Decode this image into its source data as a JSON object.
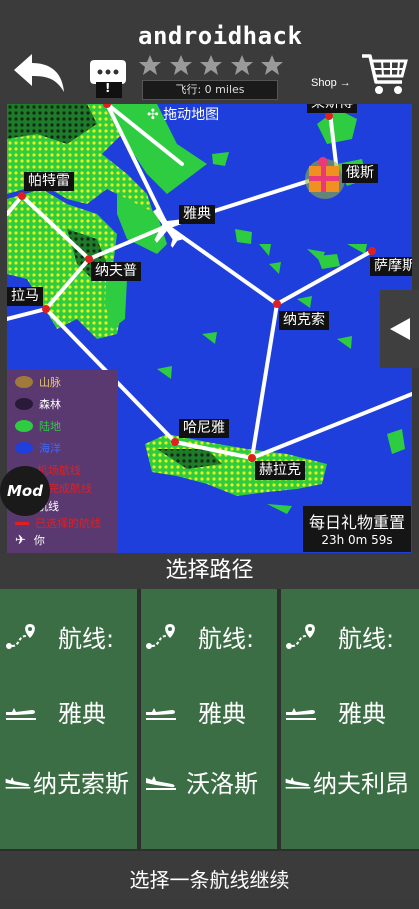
{
  "header": {
    "username": "androidhack",
    "stars_filled": 0,
    "stars_total": 5,
    "flight_label": "飞行: 0 miles",
    "shop_label": "Shop →",
    "message_badge": "!"
  },
  "map": {
    "drag_hint": "拖动地图",
    "cities": [
      "帕特雷",
      "雅典",
      "纳夫普",
      "拉马",
      "纳克索",
      "萨摩斯",
      "哈尼雅",
      "赫拉克",
      "莱斯博",
      "俄斯"
    ],
    "legend": [
      {
        "label": "山脉",
        "color": "#a07a3a"
      },
      {
        "label": "森林",
        "color": "#2a1a3a"
      },
      {
        "label": "陆地",
        "color": "#2ecc40"
      },
      {
        "label": "海洋",
        "color": "#1e3fdb"
      },
      {
        "label": "机场航线",
        "color": "#e02020"
      },
      {
        "label": "已完成航线",
        "color": "#e02020"
      },
      {
        "label": "已选择的航线",
        "color": "#e02020"
      },
      {
        "label": "航线",
        "color": "#ffffff"
      },
      {
        "label": "你",
        "color": "#ffffff"
      }
    ],
    "daily_gift_title": "每日礼物重置",
    "daily_gift_timer": "23h 0m 59s",
    "mod_label": "Mod"
  },
  "routes": {
    "title": "选择路径",
    "cards": [
      {
        "route_label": "航线:",
        "from": "雅典",
        "to": "纳克索斯"
      },
      {
        "route_label": "航线:",
        "from": "雅典",
        "to": "沃洛斯"
      },
      {
        "route_label": "航线:",
        "from": "雅典",
        "to": "纳夫利昂"
      }
    ],
    "footer": "选择一条航线继续"
  },
  "colors": {
    "background": "#3a3a3a",
    "map_sea": "#1e3fdb",
    "land": "#2ecc40",
    "card_green": "#3b6e44",
    "route_line": "#ffffff",
    "city_dot": "#e02020"
  }
}
